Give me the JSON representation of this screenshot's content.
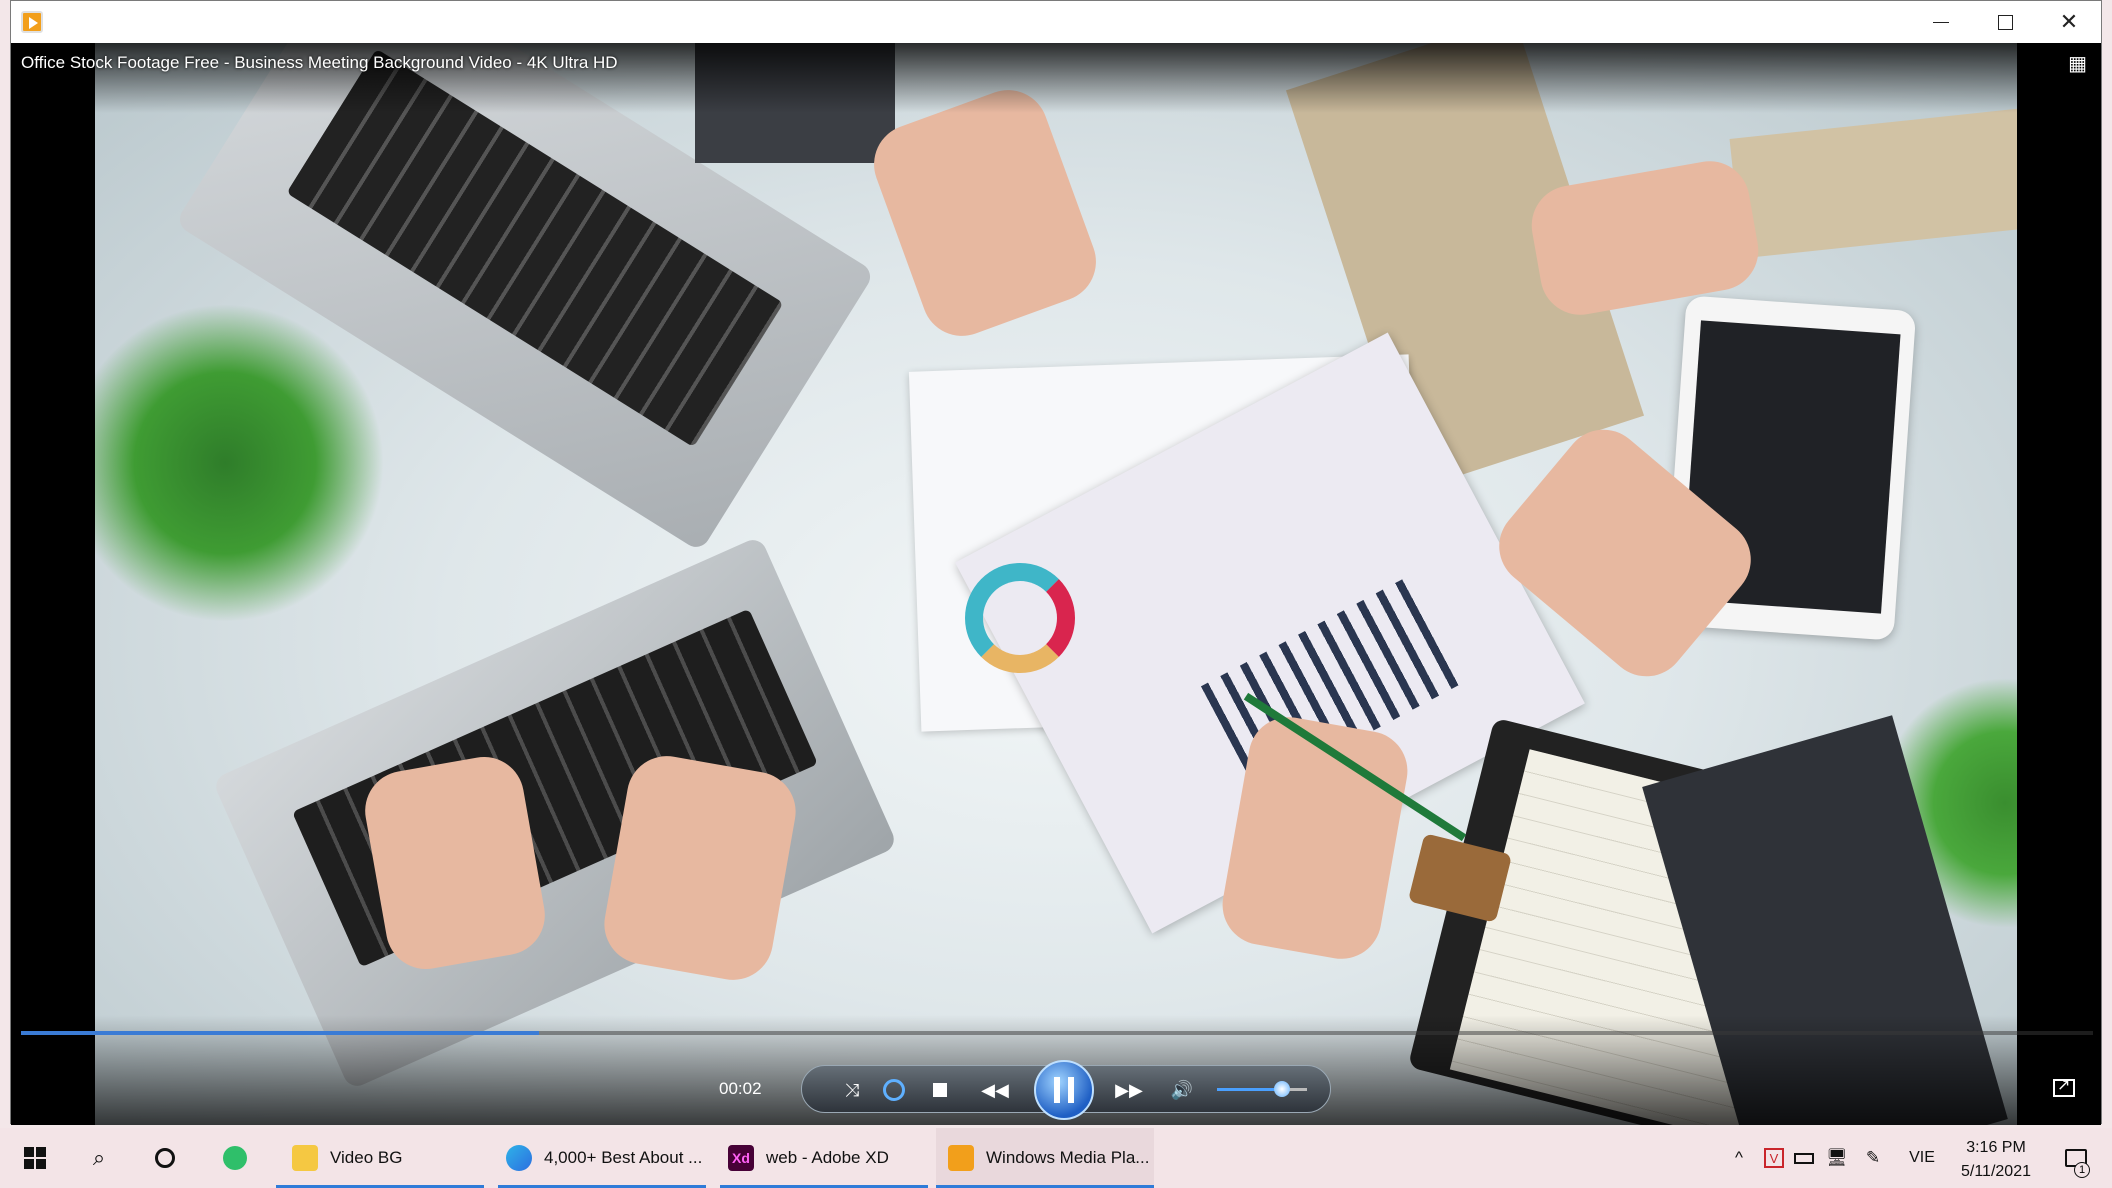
{
  "window": {
    "title": "Office Stock Footage Free - Business Meeting Background Video - 4K Ultra HD",
    "controls": {
      "minimize": "–",
      "maximize": "□",
      "close": "✕"
    }
  },
  "player": {
    "current_time": "00:02",
    "progress": 0.25,
    "volume": 0.72,
    "state": "playing",
    "icons": {
      "shuffle": "shuffle-icon",
      "repeat": "repeat-icon",
      "stop": "stop-icon",
      "previous": "rewind-icon",
      "play_pause": "pause-icon",
      "next": "fast-forward-icon",
      "volume": "speaker-icon",
      "switch_library": "switch-to-library-icon",
      "fullscreen": "fullscreen-icon"
    },
    "glyphs": {
      "shuffle": "⤨",
      "prev": "◀◀",
      "next": "▶▶",
      "volume": "🔊",
      "switch": "▦"
    }
  },
  "taskbar": {
    "apps": [
      {
        "label": "Video BG",
        "icon": "folder-icon"
      },
      {
        "label": "4,000+ Best About ...",
        "icon": "edge-icon"
      },
      {
        "label": "web - Adobe XD",
        "icon": "adobe-xd-icon",
        "icon_text": "Xd"
      },
      {
        "label": "Windows Media Pla...",
        "icon": "windows-media-player-icon",
        "active": true
      }
    ],
    "tray": {
      "language": "VIE",
      "time": "3:16 PM",
      "date": "5/11/2021",
      "notification_count": "1",
      "chevron": "^",
      "v_icon": "V"
    },
    "search_glyph": "⌕"
  },
  "colors": {
    "accent": "#3a7bd5",
    "taskbar_bg": "#f3e4e7",
    "wmp_orange": "#f29f1b"
  }
}
